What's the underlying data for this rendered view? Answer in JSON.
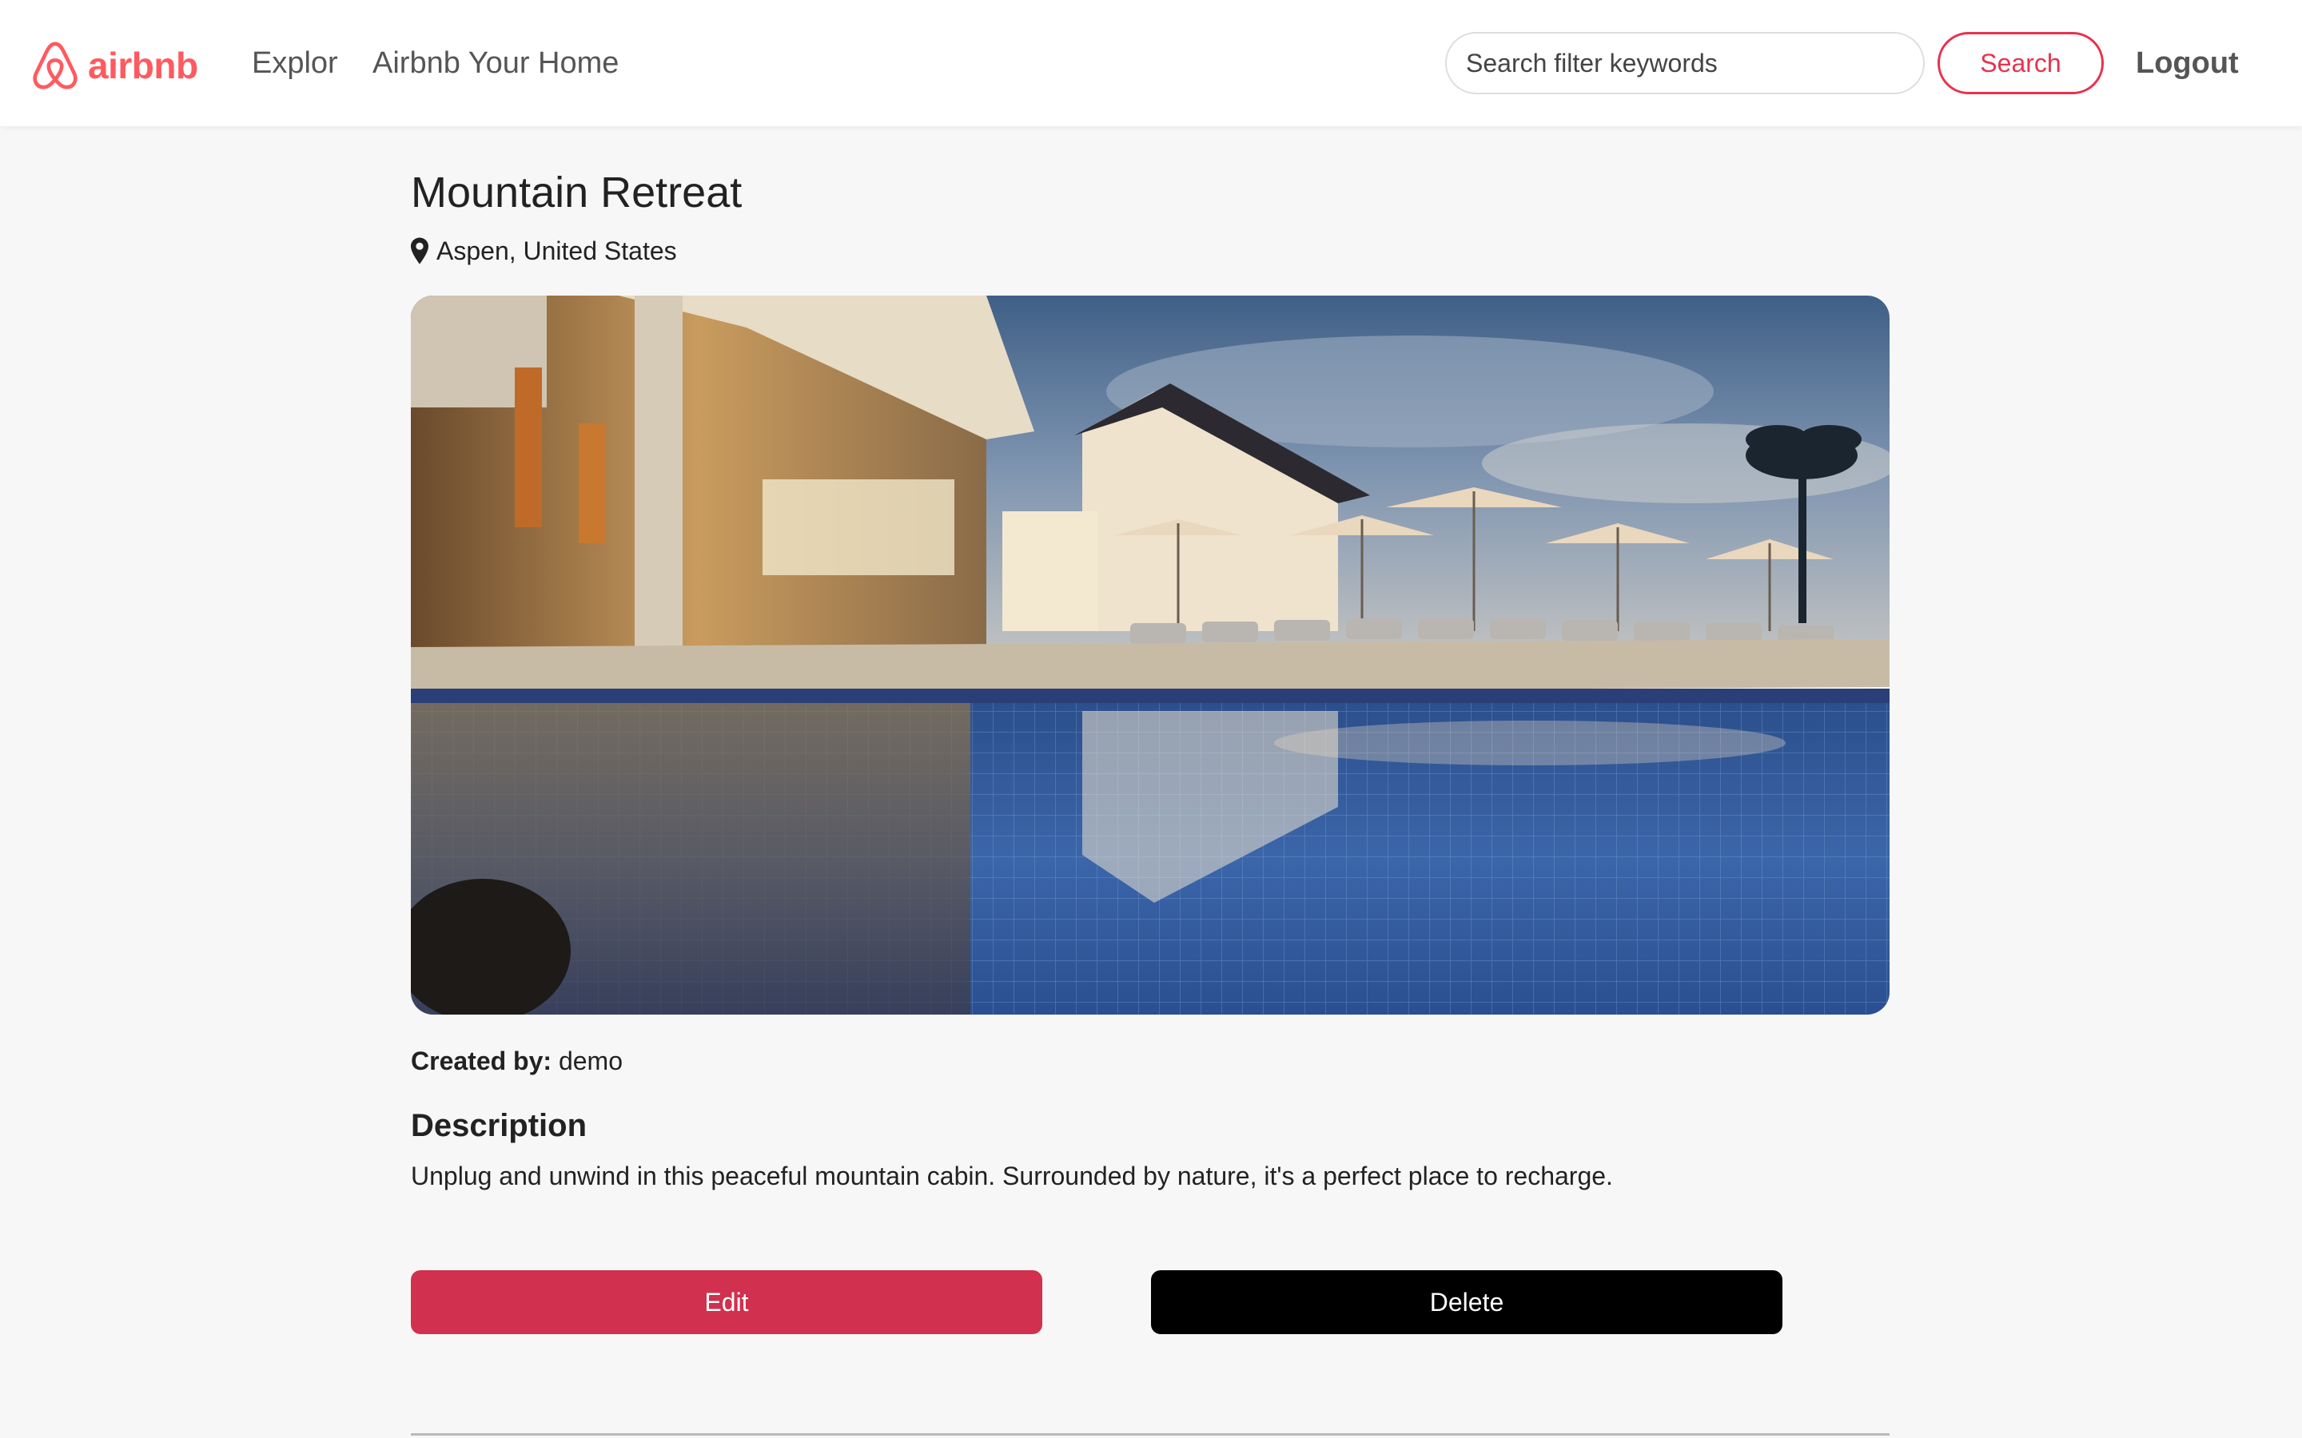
{
  "navbar": {
    "brand": "airbnb",
    "links": [
      "Explor",
      "Airbnb Your Home"
    ],
    "search_placeholder": "Search filter keywords",
    "search_button": "Search",
    "logout": "Logout"
  },
  "listing": {
    "title": "Mountain Retreat",
    "location": "Aspen, United States",
    "created_by_label": "Created by:",
    "created_by": "demo",
    "description_heading": "Description",
    "description": "Unplug and unwind in this peaceful mountain cabin. Surrounded by nature, it's a perfect place to recharge."
  },
  "actions": {
    "edit": "Edit",
    "delete": "Delete"
  },
  "colors": {
    "brand": "#ff5a5f",
    "accent": "#e8324e",
    "edit_button": "#d1304f",
    "delete_button": "#000000"
  },
  "icons": [
    "airbnb-logo-icon",
    "map-pin-icon"
  ]
}
